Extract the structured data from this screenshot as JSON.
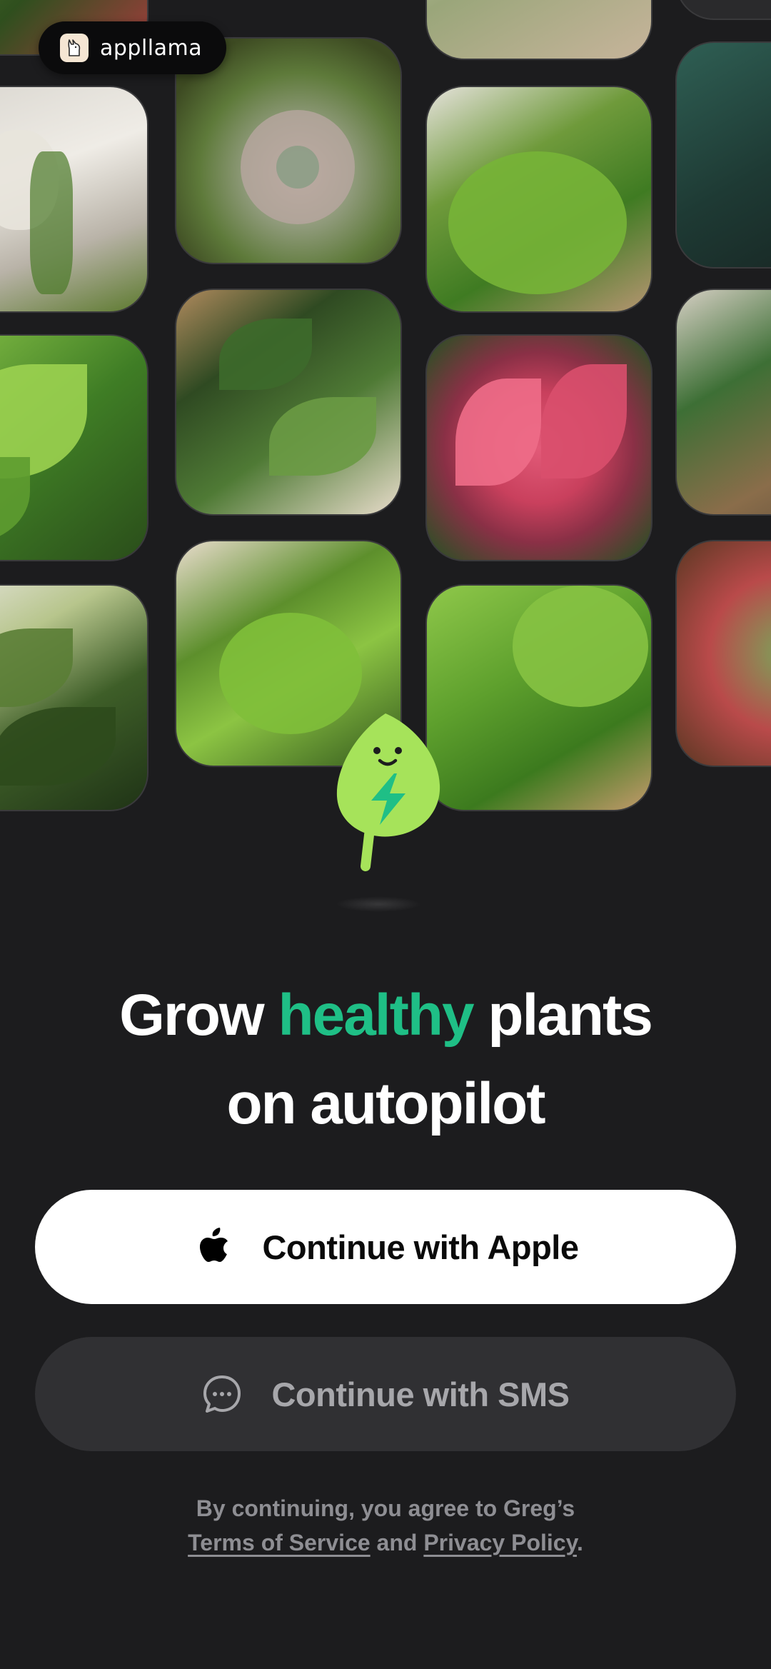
{
  "brand": {
    "name": "appllama"
  },
  "gallery": {
    "tiles": [
      {
        "name": "plant-tile-crassula"
      },
      {
        "name": "plant-tile-string-of-pearls"
      },
      {
        "name": "plant-tile-echeveria"
      },
      {
        "name": "plant-tile-monstera-large"
      },
      {
        "name": "plant-tile-agave"
      },
      {
        "name": "plant-tile-philodendron"
      },
      {
        "name": "plant-tile-prayer-plant"
      },
      {
        "name": "plant-tile-aglaonema-pink"
      },
      {
        "name": "plant-tile-calathea"
      },
      {
        "name": "plant-tile-calathea-zebra"
      },
      {
        "name": "plant-tile-monstera-small"
      },
      {
        "name": "plant-tile-alocasia"
      },
      {
        "name": "plant-tile-succulent-red"
      }
    ]
  },
  "headline": {
    "part1": "Grow ",
    "accent": "healthy",
    "part2": " plants",
    "line2": "on autopilot"
  },
  "buttons": {
    "apple": {
      "label": "Continue with Apple",
      "icon": "apple-icon"
    },
    "sms": {
      "label": "Continue with SMS",
      "icon": "chat-bubble-icon"
    }
  },
  "legal": {
    "prefix": "By continuing, you agree to Greg’s",
    "terms": "Terms of Service",
    "and": " and ",
    "privacy": "Privacy Policy",
    "suffix": "."
  },
  "colors": {
    "background": "#1c1c1e",
    "accent": "#1fbf86",
    "mascot": "#a6e35a"
  }
}
